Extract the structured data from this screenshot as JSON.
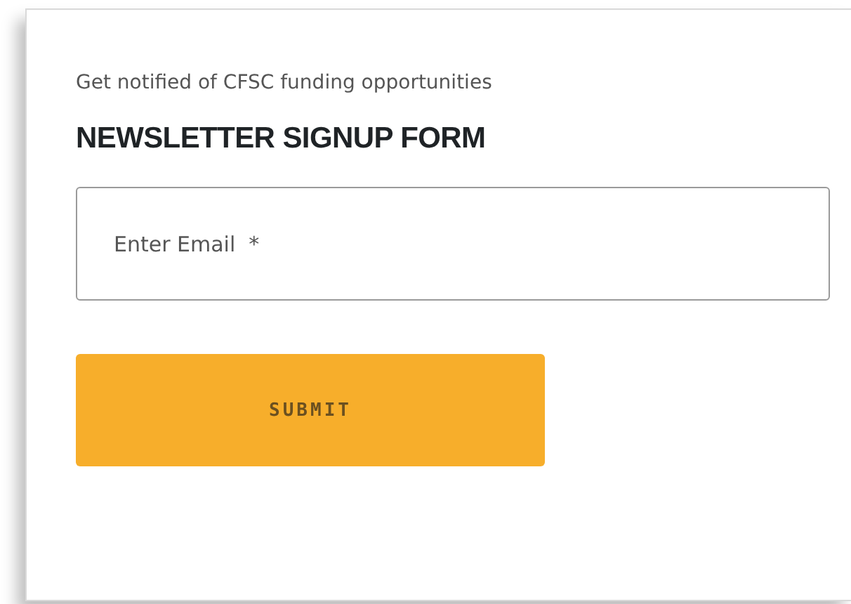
{
  "intro": "Get notified of CFSC funding opportunities",
  "title": "NEWSLETTER SIGNUP FORM",
  "email_field": {
    "placeholder": "Enter Email  *"
  },
  "submit_button": {
    "label": "SUBMIT"
  }
}
